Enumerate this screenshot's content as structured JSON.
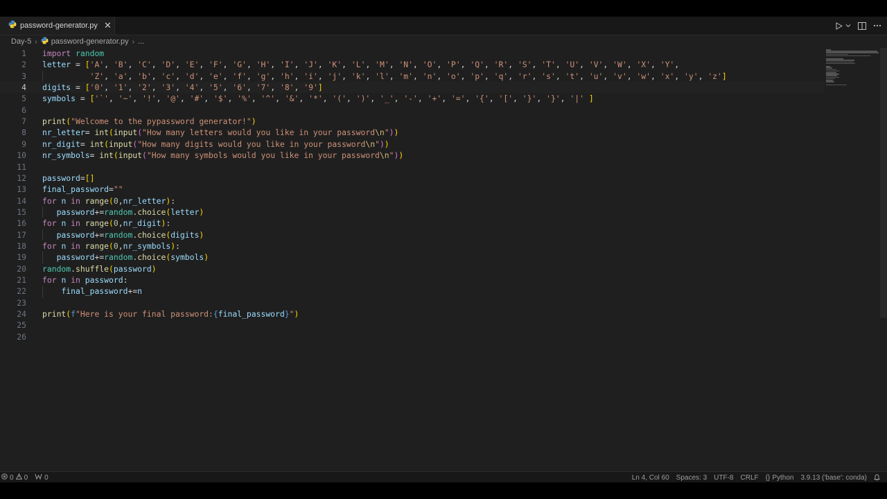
{
  "tab": {
    "filename": "password-generator.py",
    "close_glyph": "✕"
  },
  "breadcrumb": {
    "folder": "Day-5",
    "file": "password-generator.py",
    "more": "..."
  },
  "editor": {
    "active_line": 4,
    "lines": [
      "import random",
      "letter = ['A', 'B', 'C', 'D', 'E', 'F', 'G', 'H', 'I', 'J', 'K', 'L', 'M', 'N', 'O', 'P', 'Q', 'R', 'S', 'T', 'U', 'V', 'W', 'X', 'Y',",
      "          'Z', 'a', 'b', 'c', 'd', 'e', 'f', 'g', 'h', 'i', 'j', 'k', 'l', 'm', 'n', 'o', 'p', 'q', 'r', 's', 't', 'u', 'v', 'w', 'x', 'y', 'z']",
      "digits = ['0', '1', '2', '3', '4', '5', '6', '7', '8', '9']",
      "symbols = ['`', '~', '!', '@', '#', '$', '%', '^', '&', '*', '(', ')', '_', '-', '+', '=', '{', '[', '}', '}', '|' ]",
      "",
      "print(\"Welcome to the pypassword generator!\")",
      "nr_letter= int(input(\"How many letters would you like in your password\\n\"))",
      "nr_digit= int(input(\"How many digits would you like in your password\\n\"))",
      "nr_symbols= int(input(\"How many symbols would you like in your password\\n\"))",
      "",
      "password=[]",
      "final_password=\"\"",
      "for n in range(0,nr_letter):",
      "   password+=random.choice(letter)",
      "for n in range(0,nr_digit):",
      "   password+=random.choice(digits)",
      "for n in range(0,nr_symbols):",
      "   password+=random.choice(symbols)",
      "random.shuffle(password)",
      "for n in password:",
      "    final_password+=n",
      "",
      "print(f\"Here is your final password:{final_password}\")",
      "",
      ""
    ]
  },
  "statusbar": {
    "errors": "0",
    "warnings": "0",
    "ports": "0",
    "cursor": "Ln 4, Col 60",
    "spaces": "Spaces: 3",
    "encoding": "UTF-8",
    "eol": "CRLF",
    "language": "Python",
    "interpreter": "3.9.13 ('base': conda)"
  },
  "colors": {
    "background": "#1f1f1f",
    "keyword": "#c586c0",
    "string": "#ce9178",
    "function": "#dcdcaa",
    "variable": "#9cdcfe",
    "module": "#4ec9b0"
  },
  "icons": [
    "python-file-icon",
    "close-icon",
    "run-icon",
    "split-editor-icon",
    "more-actions-icon",
    "error-icon",
    "warning-icon",
    "ports-icon",
    "language-braces-icon",
    "bell-icon"
  ]
}
